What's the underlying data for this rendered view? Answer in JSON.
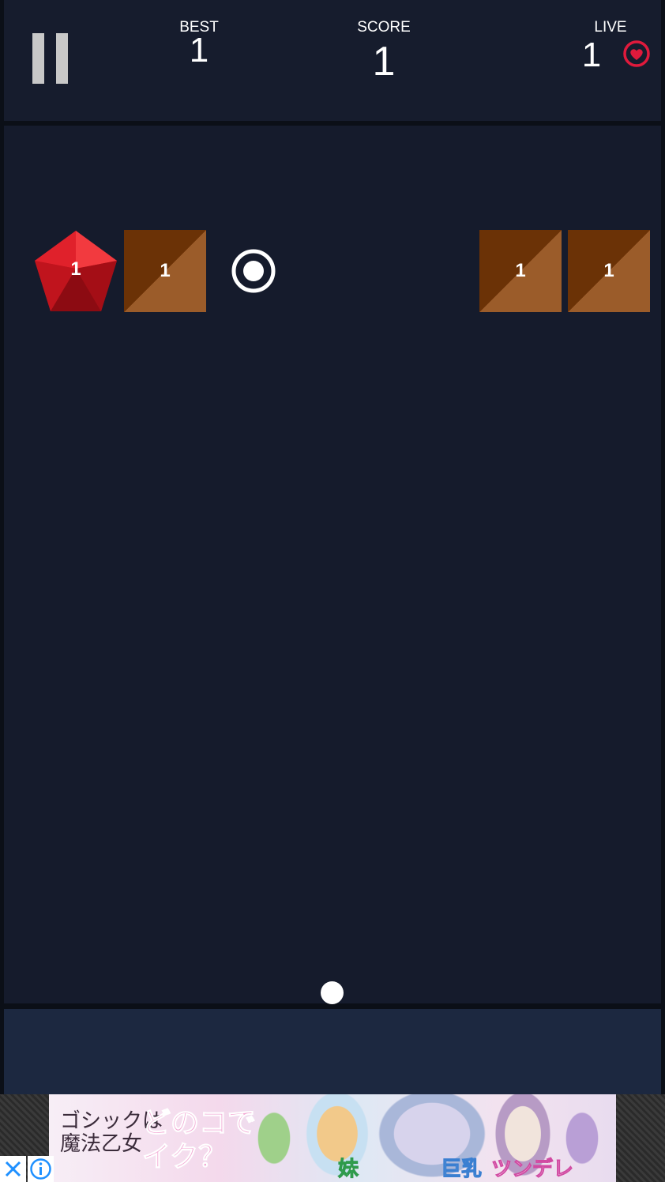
{
  "hud": {
    "best_label": "BEST",
    "best_value": "1",
    "score_label": "SCORE",
    "score_value": "1",
    "live_label": "LIVE",
    "live_value": "1"
  },
  "board": {
    "gem_value": "1",
    "bricks": [
      "1",
      "1",
      "1"
    ]
  },
  "ad": {
    "logo_line1": "ゴシックは",
    "logo_line2": "魔法乙女",
    "headline_line1": "どのコで",
    "headline_line2": "イク？",
    "tag_sister": "妹",
    "tag_busty": "巨乳",
    "tag_tsundere": "ツンデレ"
  },
  "colors": {
    "header_bg": "#161c2d",
    "playfield_bg": "#151b2c",
    "brick_dark": "#6b3206",
    "brick_light": "#9b5c2a",
    "gem_red": "#e0212b",
    "heart_red": "#e01a3c"
  },
  "icons": {
    "pause": "pause-icon",
    "heart": "heart-icon",
    "ring": "ring-target-icon",
    "ad_close": "close-icon",
    "ad_info": "info-icon"
  }
}
